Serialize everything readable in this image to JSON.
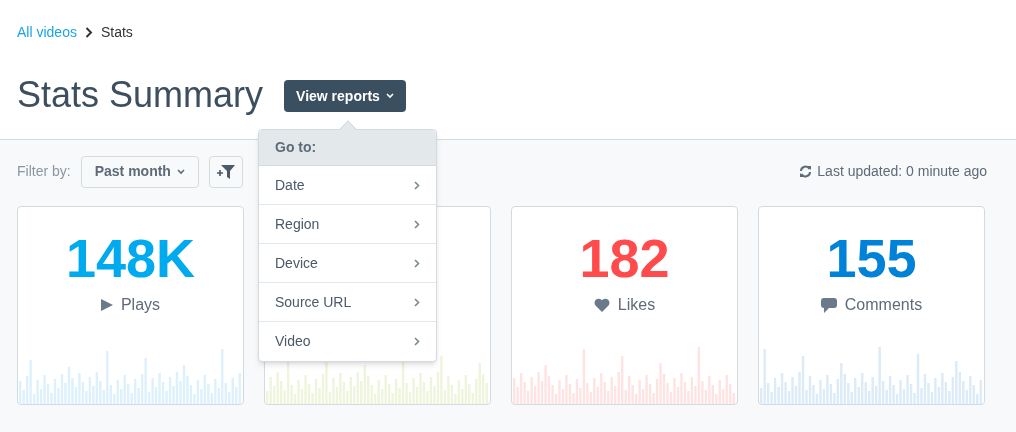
{
  "breadcrumb": {
    "link": "All videos",
    "current": "Stats"
  },
  "title": "Stats Summary",
  "view_reports": {
    "label": "View reports",
    "expanded": true
  },
  "menu": {
    "header": "Go to:",
    "items": [
      "Date",
      "Region",
      "Device",
      "Source URL",
      "Video"
    ]
  },
  "filter": {
    "label": "Filter by:",
    "value": "Past month"
  },
  "last_updated": "Last updated: 0 minute ago",
  "cards": [
    {
      "kind": "plays",
      "value": "148K",
      "label": "Plays",
      "color": "#dcf1fb"
    },
    {
      "kind": "hidden",
      "color": "#eef5dc"
    },
    {
      "kind": "likes",
      "value": "182",
      "label": "Likes",
      "color": "#ffe3e3"
    },
    {
      "kind": "comments",
      "value": "155",
      "label": "Comments",
      "color": "#dbebf8"
    }
  ]
}
